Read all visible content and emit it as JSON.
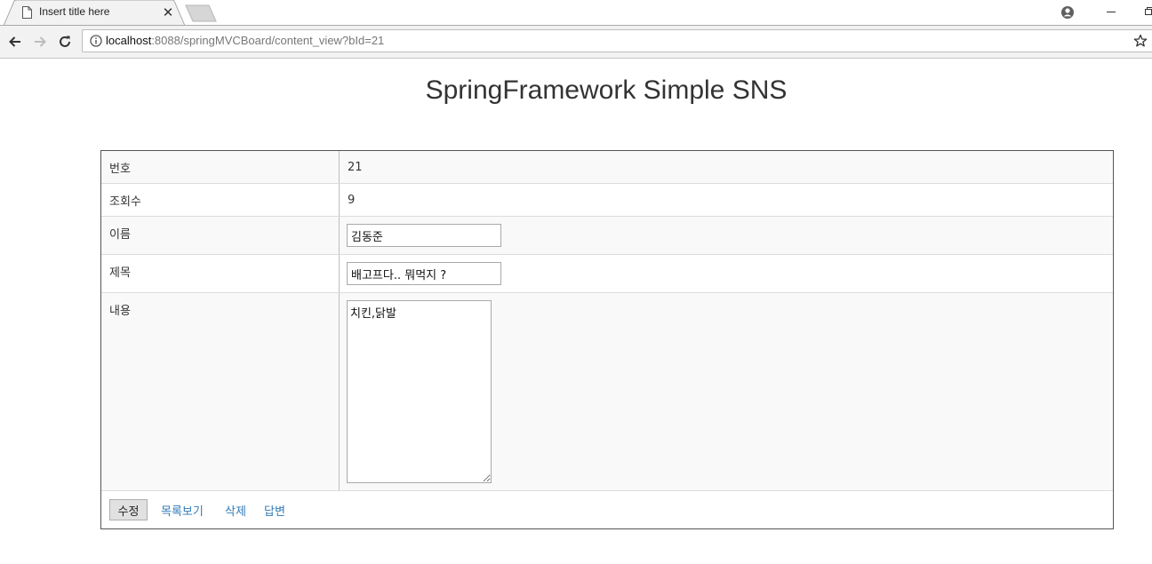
{
  "browser": {
    "tab_title": "Insert title here",
    "url_host": "localhost",
    "url_rest": ":8088/springMVCBoard/content_view?bId=21"
  },
  "page": {
    "title": "SpringFramework Simple SNS"
  },
  "board": {
    "rows": [
      {
        "label": "번호",
        "value": "21"
      },
      {
        "label": "조회수",
        "value": "9"
      },
      {
        "label": "이름",
        "value": "김동준"
      },
      {
        "label": "제목",
        "value": "배고프다.. 뭐먹지 ?"
      },
      {
        "label": "내용",
        "value": "치킨,닭발"
      }
    ],
    "actions": {
      "edit_label": "수정",
      "list_label": "목록보기",
      "delete_label": "삭제",
      "reply_label": "답변"
    }
  },
  "colors": {
    "link": "#337ab7",
    "row_shade": "#f9f9f9"
  }
}
